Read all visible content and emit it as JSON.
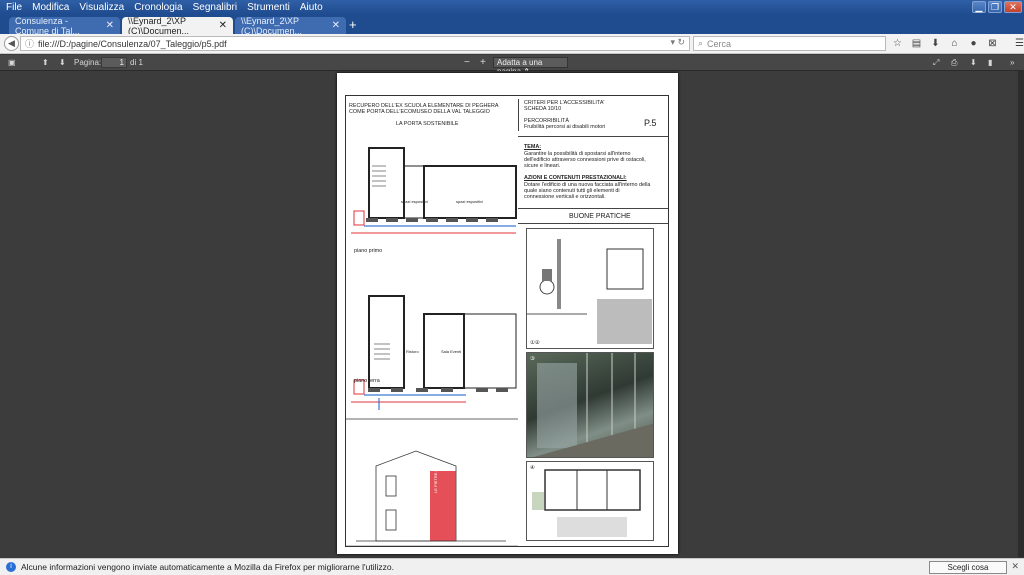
{
  "menu": [
    "File",
    "Modifica",
    "Visualizza",
    "Cronologia",
    "Segnalibri",
    "Strumenti",
    "Aiuto"
  ],
  "tabs": [
    {
      "label": "Consulenza - Comune di Tal...",
      "active": false
    },
    {
      "label": "\\\\Eynard_2\\XP (C)\\Documen...",
      "active": true
    },
    {
      "label": "\\\\Eynard_2\\XP (C)\\Documen...",
      "active": false
    }
  ],
  "nav": {
    "url": "file:///D:/pagine/Consulenza/07_Taleggio/p5.pdf",
    "search_placeholder": "Cerca"
  },
  "pdf_toolbar": {
    "page_label": "Pagina:",
    "page_value": "1",
    "page_total": "di 1",
    "zoom": "Adatta a una pagina"
  },
  "sheet": {
    "header_left": [
      "RECUPERO DELL'EX SCUOLA ELEMENTARE DI PEGHERA",
      "COME PORTA DELL'ECOMUSEO DELLA VAL TALEGGIO"
    ],
    "subtitle": "LA PORTA SOSTENIBILE",
    "header_right": [
      "CRITERI PER L'ACCESSIBILITA'",
      "SCHEDA 10/10"
    ],
    "category": "PERCORRIBILITÀ",
    "category_sub": "Fruibilità percorsi ai disabili motori",
    "code": "P.5",
    "tema_title": "TEMA:",
    "tema_text": [
      "Garantire la possibilità di spostarsi all'interno",
      "dell'edificio attraverso connessioni prive di ostacoli,",
      "sicure e lineari."
    ],
    "azioni_title": "AZIONI E CONTENUTI PRESTAZIONALI:",
    "azioni_text": [
      "Dotare l'edificio di una nuova facciata all'interno della",
      "quale siano contenuti tutti gli elementi di",
      "connessione verticali e orizzontali."
    ],
    "buone": "BUONE PRATICHE",
    "floor1_label": "piano primo",
    "floor0_label": "piano terra",
    "room_a": "spazi espositivi",
    "room_b": "spazi espositivi",
    "room_c": "Ristoro",
    "room_d": "Sala Eventi",
    "img_nums": [
      "①②",
      "③",
      "④"
    ],
    "facade_text": "LE PIETRE DELLA VALLE"
  },
  "notification": {
    "text": "Alcune informazioni vengono inviate automaticamente a Mozilla da Firefox per migliorarne l'utilizzo.",
    "button": "Scegli cosa condividere"
  },
  "colors": {
    "accent": "#2f5fa6",
    "red": "#e0303a",
    "blue": "#3a7bd5"
  }
}
